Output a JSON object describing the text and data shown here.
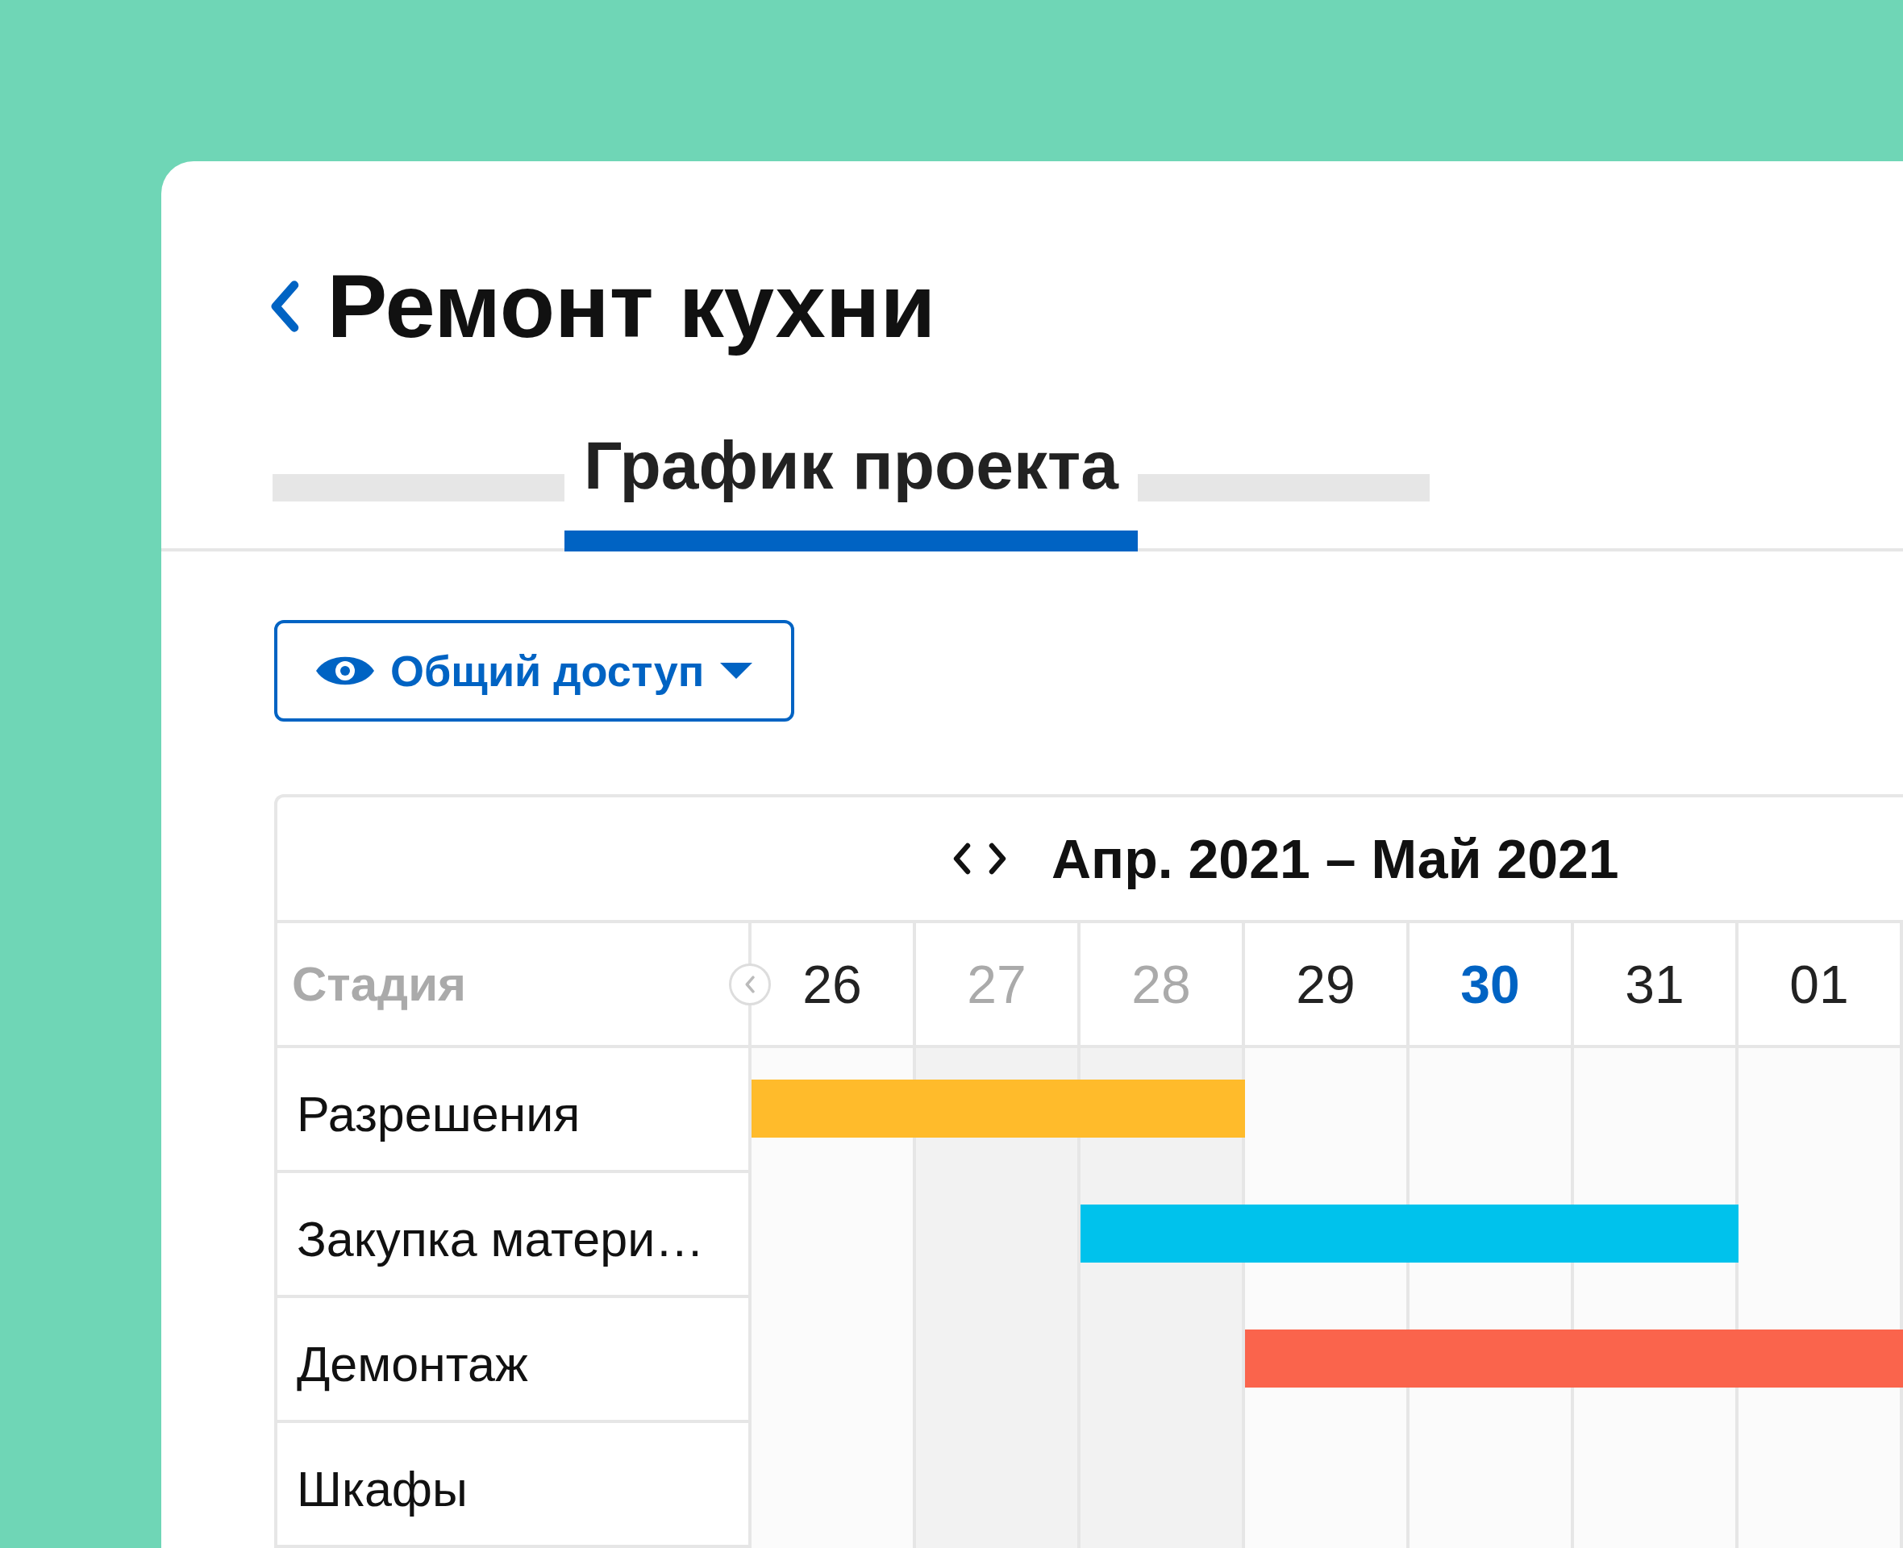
{
  "title": "Ремонт кухни",
  "tabs": [
    {
      "kind": "placeholder",
      "selected": false
    },
    {
      "kind": "tab",
      "label": "График проекта",
      "selected": true
    },
    {
      "kind": "placeholder",
      "selected": false
    }
  ],
  "share_button": {
    "label": "Общий доступ"
  },
  "gantt": {
    "period": "Апр. 2021 – Май 2021",
    "stage_header": "Стадия",
    "days": [
      {
        "label": "26",
        "weekend": false,
        "today": false
      },
      {
        "label": "27",
        "weekend": true,
        "today": false
      },
      {
        "label": "28",
        "weekend": true,
        "today": false
      },
      {
        "label": "29",
        "weekend": false,
        "today": false
      },
      {
        "label": "30",
        "weekend": false,
        "today": true
      },
      {
        "label": "31",
        "weekend": false,
        "today": false
      },
      {
        "label": "01",
        "weekend": false,
        "today": false
      }
    ],
    "rows": [
      {
        "name": "Разрешения",
        "color": "#ffbb2b",
        "span": [
          true,
          true,
          true,
          false,
          false,
          false,
          false
        ]
      },
      {
        "name": "Закупка матери…",
        "color": "#00c2ec",
        "span": [
          false,
          false,
          true,
          true,
          true,
          true,
          false
        ]
      },
      {
        "name": "Демонтаж",
        "color": "#fa644c",
        "span": [
          false,
          false,
          false,
          true,
          true,
          true,
          true
        ]
      },
      {
        "name": "Шкафы"
      }
    ]
  }
}
